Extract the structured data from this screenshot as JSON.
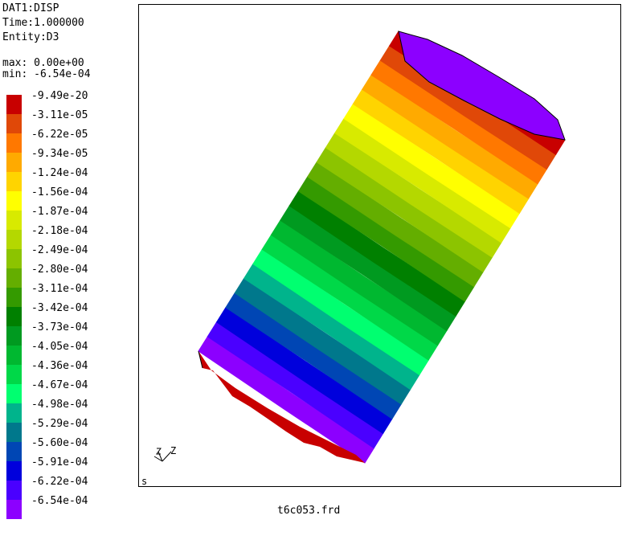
{
  "header": {
    "dataset": "DAT1:DISP",
    "time": "Time:1.000000",
    "entity": "Entity:D3",
    "max": "max: 0.00e+00",
    "min": "min: -6.54e-04"
  },
  "legend": {
    "entries": [
      {
        "label": "-9.49e-20",
        "color": "#c80000"
      },
      {
        "label": "-3.11e-05",
        "color": "#e04808"
      },
      {
        "label": "-6.22e-05",
        "color": "#ff7800"
      },
      {
        "label": "-9.34e-05",
        "color": "#ffaa00"
      },
      {
        "label": "-1.24e-04",
        "color": "#ffd400"
      },
      {
        "label": "-1.56e-04",
        "color": "#ffff00"
      },
      {
        "label": "-1.87e-04",
        "color": "#d8ea00"
      },
      {
        "label": "-2.18e-04",
        "color": "#b4d800"
      },
      {
        "label": "-2.49e-04",
        "color": "#8cc400"
      },
      {
        "label": "-2.80e-04",
        "color": "#64ae00"
      },
      {
        "label": "-3.11e-04",
        "color": "#349a00"
      },
      {
        "label": "-3.42e-04",
        "color": "#008000"
      },
      {
        "label": "-3.73e-04",
        "color": "#009a20"
      },
      {
        "label": "-4.05e-04",
        "color": "#00b830"
      },
      {
        "label": "-4.36e-04",
        "color": "#00d848"
      },
      {
        "label": "-4.67e-04",
        "color": "#00ff70"
      },
      {
        "label": "-4.98e-04",
        "color": "#00b48c"
      },
      {
        "label": "-5.29e-04",
        "color": "#00788c"
      },
      {
        "label": "-5.60e-04",
        "color": "#0046b4"
      },
      {
        "label": "-5.91e-04",
        "color": "#0000dc"
      },
      {
        "label": "-6.22e-04",
        "color": "#4a00ff"
      },
      {
        "label": "-6.54e-04",
        "color": "#8c00ff"
      }
    ]
  },
  "viewport": {
    "corner_label": "s",
    "triad_label": "Z"
  },
  "footer": {
    "filename": "t6c053.frd"
  }
}
